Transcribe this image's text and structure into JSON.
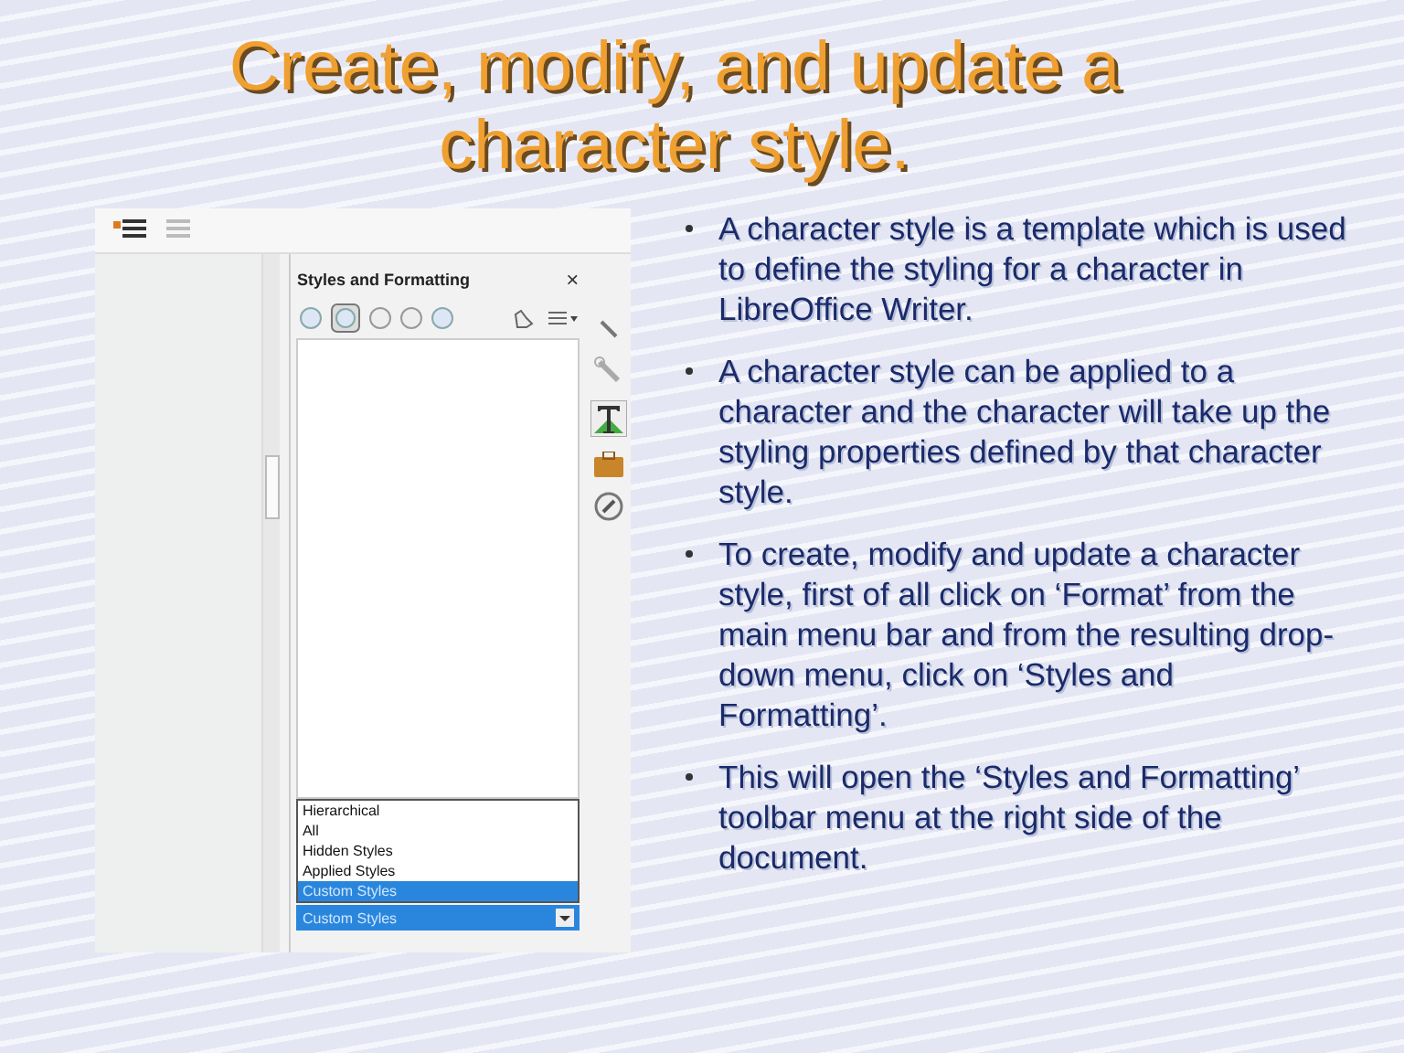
{
  "title": "Create, modify, and update a character style.",
  "screenshot": {
    "panel_title": "Styles and Formatting",
    "close": "×",
    "filter_options": [
      {
        "label": "Hierarchical",
        "selected": false
      },
      {
        "label": "All",
        "selected": false
      },
      {
        "label": "Hidden Styles",
        "selected": false
      },
      {
        "label": "Applied Styles",
        "selected": false
      },
      {
        "label": "Custom Styles",
        "selected": true
      }
    ],
    "filter_value": "Custom Styles"
  },
  "bullets": [
    "A character style is a template which is used to define the styling for a character in LibreOffice Writer.",
    "A character style can be applied to a character and the character will take up the styling properties defined by that character style.",
    "To create, modify and update a character style, first of all click on ‘Format’ from the main menu bar and from the resulting drop-down menu, click on ‘Styles and Formatting’.",
    "This will open the ‘Styles and Formatting’ toolbar menu at the right side of the document."
  ]
}
